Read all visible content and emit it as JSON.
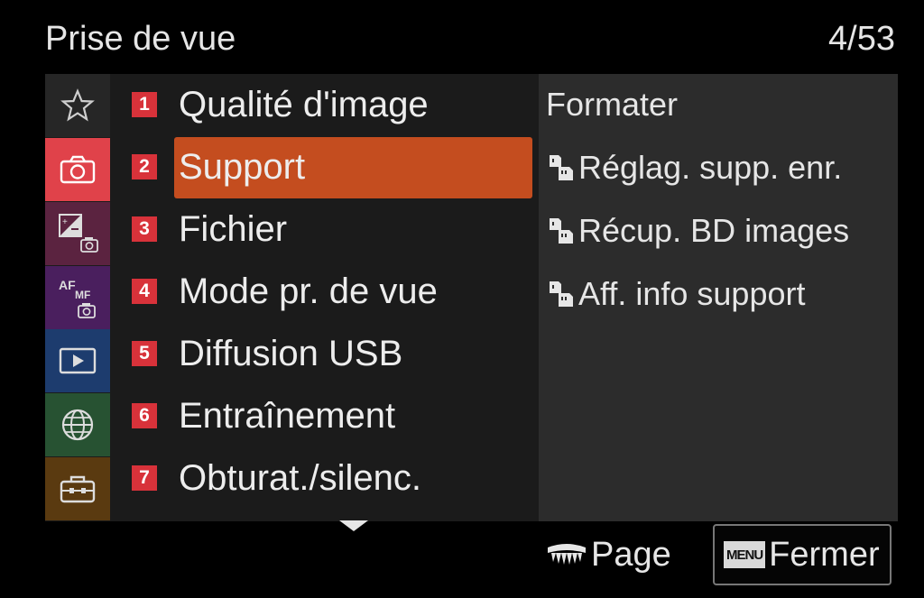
{
  "header": {
    "title": "Prise de vue",
    "page_counter": "4/53"
  },
  "tabs": [
    {
      "icon": "star-icon",
      "color": "#262626"
    },
    {
      "icon": "camera-icon",
      "color": "#e0424a"
    },
    {
      "icon": "exposure-camera-icon",
      "color": "#5b2340"
    },
    {
      "icon": "af-mf-camera-icon",
      "color": "#4a1f5e",
      "text_top": "AF",
      "text_sub": "MF"
    },
    {
      "icon": "playback-icon",
      "color": "#1d3c6e"
    },
    {
      "icon": "globe-icon",
      "color": "#275232"
    },
    {
      "icon": "toolbox-icon",
      "color": "#5a3a10"
    }
  ],
  "menu": {
    "items": [
      {
        "number": "1",
        "label": "Qualité d'image"
      },
      {
        "number": "2",
        "label": "Support"
      },
      {
        "number": "3",
        "label": "Fichier"
      },
      {
        "number": "4",
        "label": "Mode pr. de vue"
      },
      {
        "number": "5",
        "label": "Diffusion USB"
      },
      {
        "number": "6",
        "label": "Entraînement"
      },
      {
        "number": "7",
        "label": "Obturat./silenc."
      }
    ],
    "selected_index": 1,
    "selected_color": "#c44d1f"
  },
  "submenu": {
    "items": [
      {
        "label": "Formater",
        "icon": ""
      },
      {
        "label": "Réglag. supp. enr.",
        "icon": "dual-card-icon"
      },
      {
        "label": "Récup. BD images",
        "icon": "dual-card-icon"
      },
      {
        "label": "Aff. info support",
        "icon": "dual-card-icon"
      }
    ]
  },
  "footer": {
    "page_label": "Page",
    "page_icon": "dial-icon",
    "menu_key": "MENU",
    "close_label": "Fermer"
  }
}
